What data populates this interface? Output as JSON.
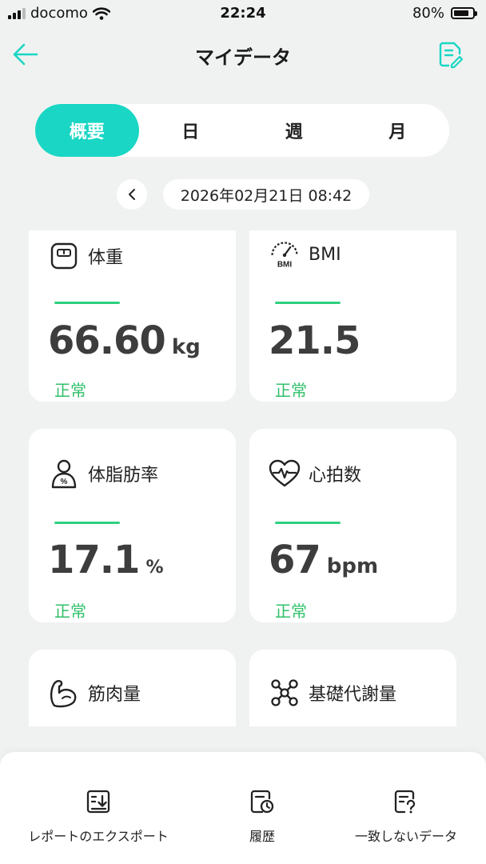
{
  "status_bar": {
    "carrier": "docomo",
    "time": "22:24",
    "battery": "80%",
    "battery_level": 0.8
  },
  "header": {
    "title": "マイデータ"
  },
  "tabs": [
    {
      "label": "概要",
      "active": true
    },
    {
      "label": "日",
      "active": false
    },
    {
      "label": "週",
      "active": false
    },
    {
      "label": "月",
      "active": false
    }
  ],
  "date": {
    "value": "2026年02月21日 08:42"
  },
  "cards": {
    "weight": {
      "label": "体重",
      "value": "66.60",
      "unit": "kg",
      "status": "正常"
    },
    "bmi": {
      "label": "BMI",
      "value": "21.5",
      "unit": "",
      "status": "正常"
    },
    "body_fat": {
      "label": "体脂肪率",
      "value": "17.1",
      "unit": "%",
      "status": "正常"
    },
    "heart_rate": {
      "label": "心拍数",
      "value": "67",
      "unit": "bpm",
      "status": "正常"
    },
    "muscle": {
      "label": "筋肉量"
    },
    "bmr": {
      "label": "基礎代謝量"
    }
  },
  "icons": {
    "bmi_icon_text": "BMI"
  },
  "bottom_bar": {
    "export_label": "レポートのエクスポート",
    "history_label": "履歴",
    "mismatch_label": "一致しないデータ"
  },
  "colors": {
    "accent": "#1ad6c4",
    "status_ok": "#2fc06a"
  }
}
